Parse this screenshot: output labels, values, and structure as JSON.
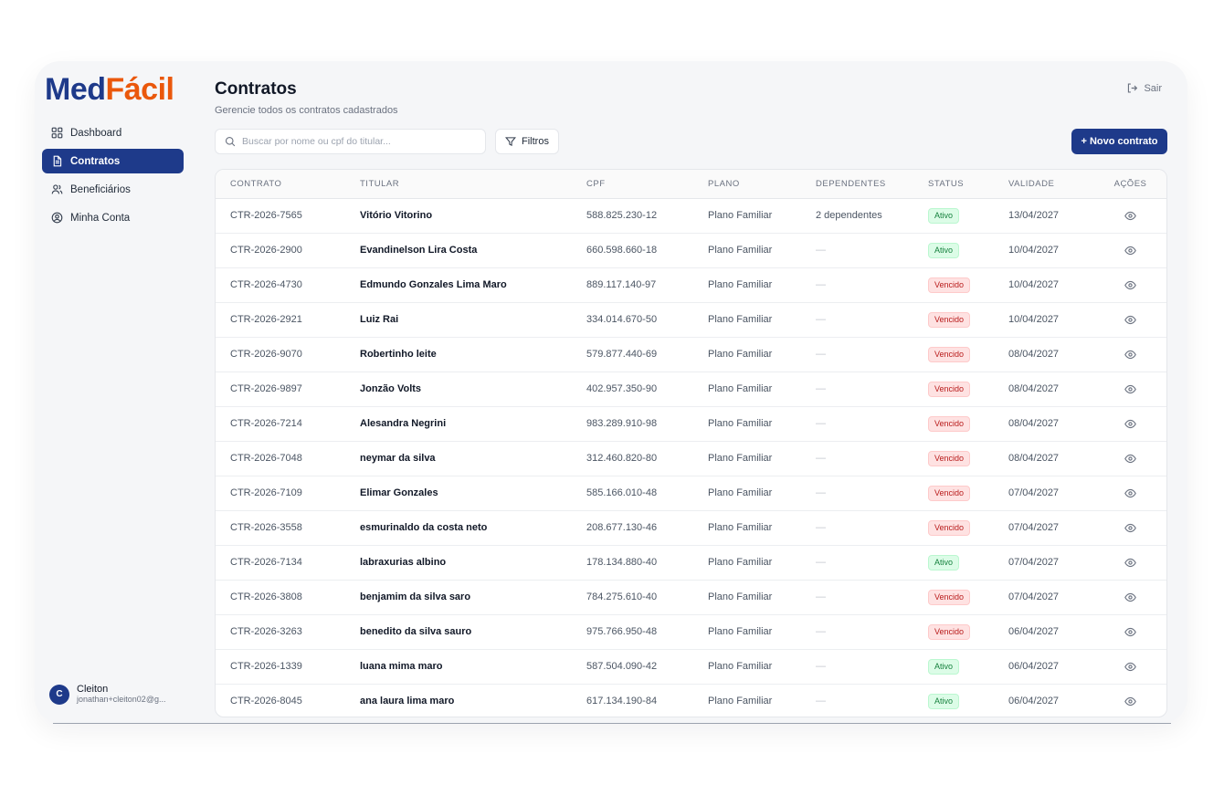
{
  "brand": {
    "part1": "Med",
    "part2": "Fácil",
    "color1": "#1e3a8a",
    "color2": "#ea580c"
  },
  "sidebar": {
    "items": [
      {
        "label": "Dashboard",
        "icon": "dashboard-icon",
        "active": false
      },
      {
        "label": "Contratos",
        "icon": "document-icon",
        "active": true
      },
      {
        "label": "Beneficiários",
        "icon": "users-icon",
        "active": false
      },
      {
        "label": "Minha Conta",
        "icon": "user-circle-icon",
        "active": false
      }
    ]
  },
  "user": {
    "initial": "C",
    "name": "Cleiton",
    "email": "jonathan+cleiton02@g..."
  },
  "header": {
    "title": "Contratos",
    "subtitle": "Gerencie todos os contratos cadastrados",
    "logout_label": "Sair"
  },
  "toolbar": {
    "search_placeholder": "Buscar por nome ou cpf do titular...",
    "search_value": "",
    "filters_label": "Filtros",
    "new_label": "+ Novo contrato"
  },
  "table": {
    "columns": [
      "Contrato",
      "Titular",
      "CPF",
      "Plano",
      "Dependentes",
      "Status",
      "Validade",
      "Ações"
    ],
    "rows": [
      {
        "contrato": "CTR-2026-7565",
        "titular": "Vitório Vitorino",
        "cpf": "588.825.230-12",
        "plano": "Plano Familiar",
        "dependentes": "2 dependentes",
        "status": "Ativo",
        "validade": "13/04/2027"
      },
      {
        "contrato": "CTR-2026-2900",
        "titular": "Evandinelson Lira Costa",
        "cpf": "660.598.660-18",
        "plano": "Plano Familiar",
        "dependentes": "—",
        "status": "Ativo",
        "validade": "10/04/2027"
      },
      {
        "contrato": "CTR-2026-4730",
        "titular": "Edmundo Gonzales Lima Maro",
        "cpf": "889.117.140-97",
        "plano": "Plano Familiar",
        "dependentes": "—",
        "status": "Vencido",
        "validade": "10/04/2027"
      },
      {
        "contrato": "CTR-2026-2921",
        "titular": "Luiz Rai",
        "cpf": "334.014.670-50",
        "plano": "Plano Familiar",
        "dependentes": "—",
        "status": "Vencido",
        "validade": "10/04/2027"
      },
      {
        "contrato": "CTR-2026-9070",
        "titular": "Robertinho leite",
        "cpf": "579.877.440-69",
        "plano": "Plano Familiar",
        "dependentes": "—",
        "status": "Vencido",
        "validade": "08/04/2027"
      },
      {
        "contrato": "CTR-2026-9897",
        "titular": "Jonzão Volts",
        "cpf": "402.957.350-90",
        "plano": "Plano Familiar",
        "dependentes": "—",
        "status": "Vencido",
        "validade": "08/04/2027"
      },
      {
        "contrato": "CTR-2026-7214",
        "titular": "Alesandra Negrini",
        "cpf": "983.289.910-98",
        "plano": "Plano Familiar",
        "dependentes": "—",
        "status": "Vencido",
        "validade": "08/04/2027"
      },
      {
        "contrato": "CTR-2026-7048",
        "titular": "neymar da silva",
        "cpf": "312.460.820-80",
        "plano": "Plano Familiar",
        "dependentes": "—",
        "status": "Vencido",
        "validade": "08/04/2027"
      },
      {
        "contrato": "CTR-2026-7109",
        "titular": "Elimar Gonzales",
        "cpf": "585.166.010-48",
        "plano": "Plano Familiar",
        "dependentes": "—",
        "status": "Vencido",
        "validade": "07/04/2027"
      },
      {
        "contrato": "CTR-2026-3558",
        "titular": "esmurinaldo da costa neto",
        "cpf": "208.677.130-46",
        "plano": "Plano Familiar",
        "dependentes": "—",
        "status": "Vencido",
        "validade": "07/04/2027"
      },
      {
        "contrato": "CTR-2026-7134",
        "titular": "labraxurias albino",
        "cpf": "178.134.880-40",
        "plano": "Plano Familiar",
        "dependentes": "—",
        "status": "Ativo",
        "validade": "07/04/2027"
      },
      {
        "contrato": "CTR-2026-3808",
        "titular": "benjamim da silva saro",
        "cpf": "784.275.610-40",
        "plano": "Plano Familiar",
        "dependentes": "—",
        "status": "Vencido",
        "validade": "07/04/2027"
      },
      {
        "contrato": "CTR-2026-3263",
        "titular": "benedito da silva sauro",
        "cpf": "975.766.950-48",
        "plano": "Plano Familiar",
        "dependentes": "—",
        "status": "Vencido",
        "validade": "06/04/2027"
      },
      {
        "contrato": "CTR-2026-1339",
        "titular": "luana mima maro",
        "cpf": "587.504.090-42",
        "plano": "Plano Familiar",
        "dependentes": "—",
        "status": "Ativo",
        "validade": "06/04/2027"
      },
      {
        "contrato": "CTR-2026-8045",
        "titular": "ana laura lima maro",
        "cpf": "617.134.190-84",
        "plano": "Plano Familiar",
        "dependentes": "—",
        "status": "Ativo",
        "validade": "06/04/2027"
      }
    ]
  },
  "colors": {
    "primary": "#1e3a8a",
    "active_badge": "#15803d",
    "expired_badge": "#b91c1c"
  }
}
